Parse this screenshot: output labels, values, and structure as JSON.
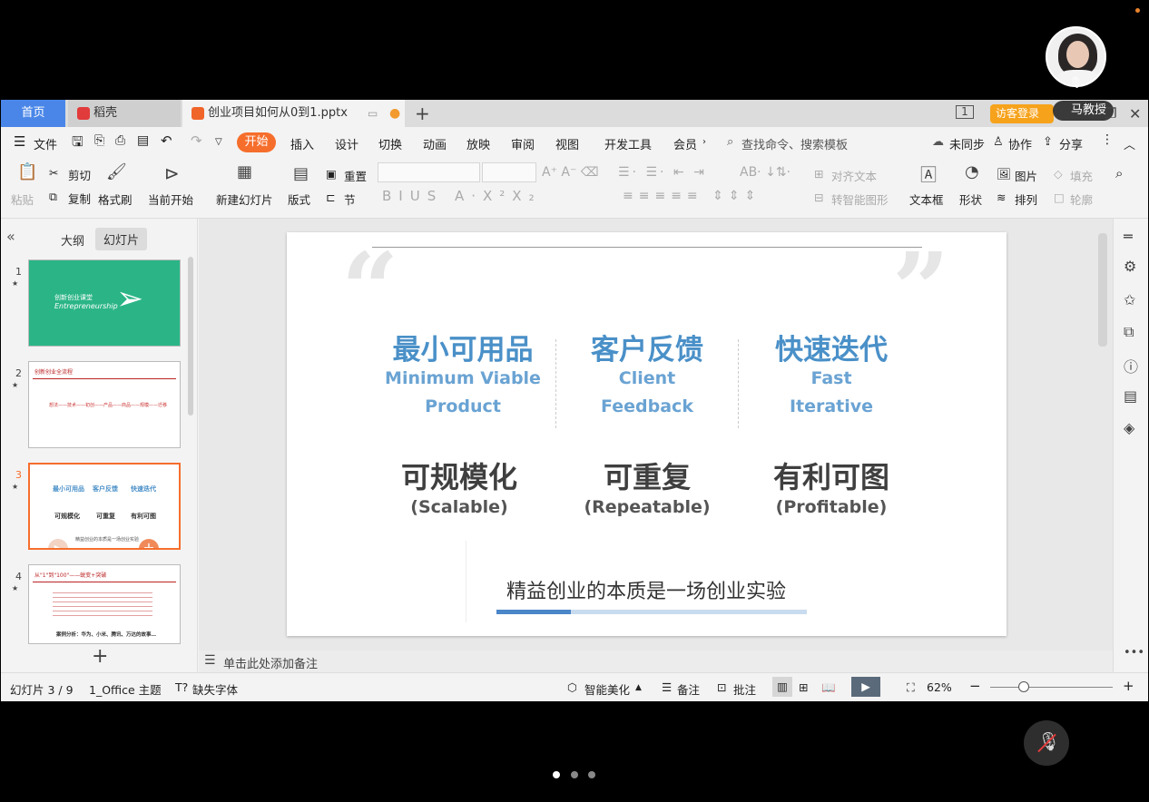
{
  "overlay": {
    "presenter_name": "马教授",
    "page_dots": 3,
    "active_dot": 0
  },
  "tabs": {
    "home": "首页",
    "daoke": "稻壳",
    "doc": "创业项目如何从0到1.pptx"
  },
  "header": {
    "visitor_login": "访客登录"
  },
  "menu": {
    "file": "文件",
    "items": [
      "开始",
      "插入",
      "设计",
      "切换",
      "动画",
      "放映",
      "审阅",
      "视图",
      "开发工具",
      "会员"
    ],
    "search": "查找命令、搜索模板",
    "sync": "未同步",
    "collab": "协作",
    "share": "分享"
  },
  "ribbon": {
    "paste": "粘贴",
    "cut": "剪切",
    "copy": "复制",
    "format_painter": "格式刷",
    "from_current": "当前开始",
    "new_slide": "新建幻灯片",
    "layout": "版式",
    "reset": "重置",
    "section": "节",
    "align_text": "对齐文本",
    "smart_art": "转智能图形",
    "text_box": "文本框",
    "shape": "形状",
    "picture": "图片",
    "fill": "填充",
    "arrange": "排列",
    "outline": "轮廓"
  },
  "leftpanel": {
    "tab_outline": "大纲",
    "tab_slides": "幻灯片",
    "slides": [
      {
        "num": "1",
        "title": "创新创业课堂",
        "subtitle": "Entrepreneurship"
      },
      {
        "num": "2",
        "title": "创新创业全流程",
        "body": "想法——技术——初创——产品——商品——规模——迁移"
      },
      {
        "num": "3",
        "active": true
      },
      {
        "num": "4",
        "title": "从\"1\"到\"100\"——蜕变+突破",
        "body": "案例分析：华为、小米、腾讯、万达的故事…"
      }
    ]
  },
  "slide": {
    "top_row": [
      {
        "zh": "最小可用品",
        "en1": "Minimum Viable",
        "en2": "Product"
      },
      {
        "zh": "客户反馈",
        "en1": "Client",
        "en2": "Feedback"
      },
      {
        "zh": "快速迭代",
        "en1": "Fast",
        "en2": "Iterative"
      }
    ],
    "bottom_row": [
      {
        "zh": "可规模化",
        "en": "(Scalable)"
      },
      {
        "zh": "可重复",
        "en": "(Repeatable)"
      },
      {
        "zh": "有利可图",
        "en": "(Profitable)"
      }
    ],
    "conclusion": "精益创业的本质是一场创业实验"
  },
  "notes": {
    "placeholder": "单击此处添加备注"
  },
  "status": {
    "slide_pos": "幻灯片 3 / 9",
    "theme": "1_Office 主题",
    "missing_font": "缺失字体",
    "beautify": "智能美化",
    "notes": "备注",
    "comments": "批注",
    "zoom": "62%"
  },
  "colors": {
    "accent_orange": "#f66e2c",
    "tab_blue": "#4a86e8",
    "slide_blue": "#4a90c8",
    "thumb_green": "#2bb587"
  }
}
